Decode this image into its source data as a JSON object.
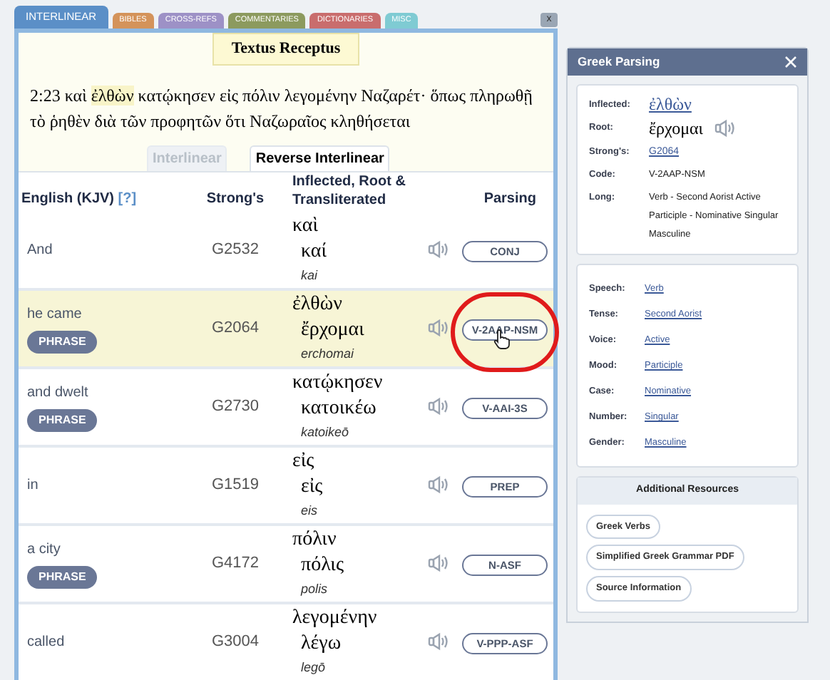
{
  "tabs": [
    {
      "label": "INTERLINEAR",
      "color": "#5b8fc7",
      "selected": true
    },
    {
      "label": "BIBLES",
      "color": "#d4935a",
      "selected": false
    },
    {
      "label": "CROSS-REFS",
      "color": "#9d91c6",
      "selected": false
    },
    {
      "label": "COMMENTARIES",
      "color": "#8c9a5e",
      "selected": false
    },
    {
      "label": "DICTIONARIES",
      "color": "#c96d6d",
      "selected": false
    },
    {
      "label": "MISC",
      "color": "#7fcbd3",
      "selected": false
    }
  ],
  "close_label": "x",
  "source_label": "Textus Receptus",
  "verse": {
    "reference": "2:23",
    "segments": [
      {
        "text": "καὶ",
        "highlighted": false
      },
      {
        "text": "ἐλθὼν",
        "highlighted": true
      },
      {
        "text": "κατῴκησεν εἰς πόλιν λεγομένην Ναζαρέτ· ὅπως πληρωθῇ τὸ ῥηθὲν διὰ τῶν προφητῶν ὅτι Ναζωραῖος κληθήσεται",
        "highlighted": false
      }
    ]
  },
  "view_tabs": [
    {
      "label": "Interlinear",
      "selected": false
    },
    {
      "label": "Reverse Interlinear",
      "selected": true
    }
  ],
  "columns": {
    "english": "English (KJV)",
    "help": "[?]",
    "strongs": "Strong's",
    "greek": "Inflected, Root & Transliterated",
    "parsing": "Parsing"
  },
  "rows": [
    {
      "english": "And",
      "phrase": "",
      "strongs": "G2532",
      "inflected": "καὶ",
      "root": "καί",
      "translit": "kai",
      "parsing": "CONJ",
      "selected": false,
      "circled": false
    },
    {
      "english": "he came",
      "phrase": "PHRASE",
      "strongs": "G2064",
      "inflected": "ἐλθὼν",
      "root": "ἔρχομαι",
      "translit": "erchomai",
      "parsing": "V-2AAP-NSM",
      "selected": true,
      "circled": true
    },
    {
      "english": "and dwelt",
      "phrase": "PHRASE",
      "strongs": "G2730",
      "inflected": "κατῴκησεν",
      "root": "κατοικέω",
      "translit": "katoikeō",
      "parsing": "V-AAI-3S",
      "selected": false,
      "circled": false
    },
    {
      "english": "in",
      "phrase": "",
      "strongs": "G1519",
      "inflected": "εἰς",
      "root": "εἰς",
      "translit": "eis",
      "parsing": "PREP",
      "selected": false,
      "circled": false
    },
    {
      "english": "a city",
      "phrase": "PHRASE",
      "strongs": "G4172",
      "inflected": "πόλιν",
      "root": "πόλις",
      "translit": "polis",
      "parsing": "N-ASF",
      "selected": false,
      "circled": false
    },
    {
      "english": "called",
      "phrase": "",
      "strongs": "G3004",
      "inflected": "λεγομένην",
      "root": "λέγω",
      "translit": "legō",
      "parsing": "V-PPP-ASF",
      "selected": false,
      "circled": false
    }
  ],
  "parsing_panel": {
    "title": "Greek Parsing",
    "summary": [
      {
        "label": "Inflected:",
        "value": "ἐλθὼν",
        "kind": "greek-link"
      },
      {
        "label": "Root:",
        "value": "ἔρχομαι",
        "kind": "greek-audio"
      },
      {
        "label": "Strong's:",
        "value": "G2064",
        "kind": "link"
      },
      {
        "label": "Code:",
        "value": "V-2AAP-NSM",
        "kind": "text"
      },
      {
        "label": "Long:",
        "value": "Verb - Second Aorist Active Participle - Nominative Singular Masculine",
        "kind": "text"
      }
    ],
    "details": [
      {
        "label": "Speech:",
        "value": "Verb"
      },
      {
        "label": "Tense:",
        "value": "Second Aorist"
      },
      {
        "label": "Voice:",
        "value": "Active"
      },
      {
        "label": "Mood:",
        "value": "Participle"
      },
      {
        "label": "Case:",
        "value": "Nominative"
      },
      {
        "label": "Number:",
        "value": "Singular"
      },
      {
        "label": "Gender:",
        "value": "Masculine"
      }
    ],
    "resources_title": "Additional Resources",
    "resources": [
      "Greek Verbs",
      "Simplified Greek Grammar PDF",
      "Source Information"
    ]
  }
}
